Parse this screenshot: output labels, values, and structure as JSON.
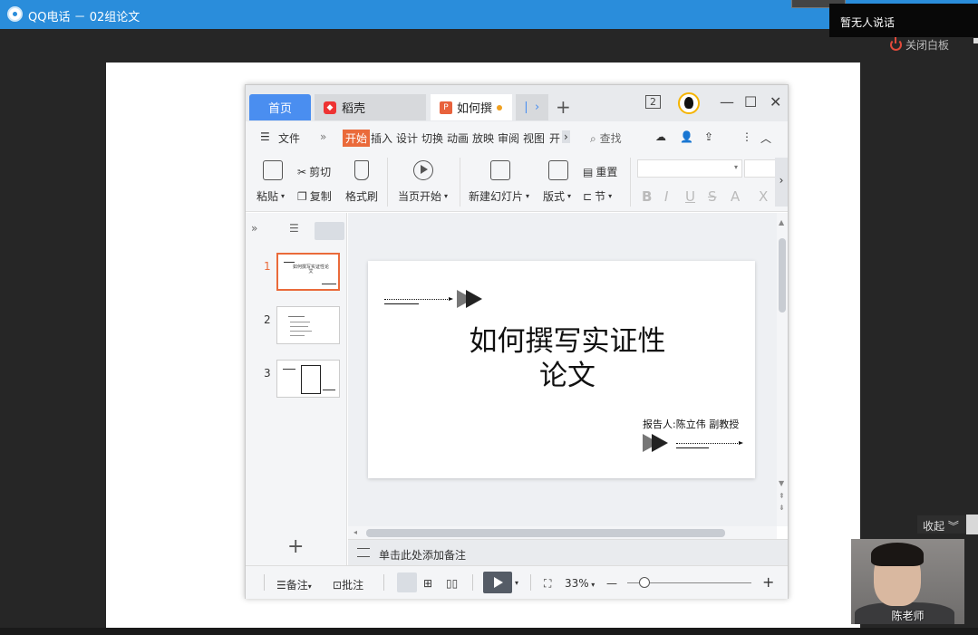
{
  "qq": {
    "title": "QQ电话 － 02组论文",
    "no_speaker": "暂无人说话",
    "close_whiteboard": "关闭白板",
    "collapse": "收起",
    "video_name": "陈老师"
  },
  "wps": {
    "tabs": {
      "home": "首页",
      "daoke": "稻壳",
      "doc": "如何撰"
    },
    "window_badge": "2",
    "menu": {
      "file": "文件",
      "items": [
        "开始",
        "插入",
        "设计",
        "切换",
        "动画",
        "放映",
        "审阅",
        "视图",
        "开"
      ],
      "active_index": 0,
      "search": "查找"
    },
    "ribbon": {
      "paste": "粘贴",
      "cut": "剪切",
      "copy": "复制",
      "format_painter": "格式刷",
      "from_current": "当页开始",
      "new_slide": "新建幻灯片",
      "layout": "版式",
      "reset": "重置",
      "section": "节"
    },
    "slides": [
      {
        "num": "1",
        "active": true,
        "title": "如何撰写实证性论文"
      },
      {
        "num": "2",
        "active": false
      },
      {
        "num": "3",
        "active": false
      }
    ],
    "slide": {
      "title_line1": "如何撰写实证性",
      "title_line2": "论文",
      "reporter": "报告人:陈立伟 副教授"
    },
    "notes_placeholder": "单击此处添加备注",
    "status": {
      "notes": "备注",
      "comment": "批注",
      "zoom": "33%"
    },
    "colors": {
      "accent": "#ea6a3a",
      "home_tab": "#4a8ef0"
    }
  }
}
